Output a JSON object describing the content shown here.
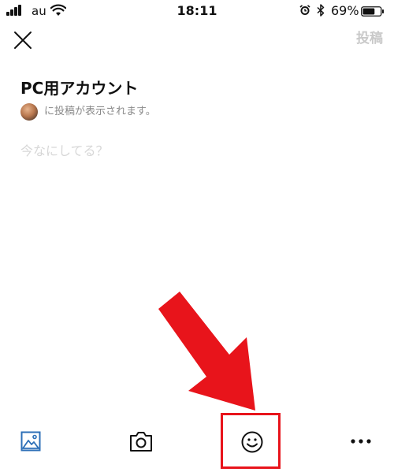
{
  "status_bar": {
    "carrier": "au",
    "time": "18:11",
    "battery_percent": "69%",
    "battery_level": 0.69,
    "signal_bars": 4
  },
  "header": {
    "close_icon": "close-icon",
    "post_label": "投稿"
  },
  "account": {
    "name": "PC用アカウント",
    "visibility_text": "に投稿が表示されます。"
  },
  "composer": {
    "placeholder": "今なにしてる？"
  },
  "toolbar": {
    "items": [
      {
        "icon": "photo-icon"
      },
      {
        "icon": "camera-icon"
      },
      {
        "icon": "emoji-icon"
      },
      {
        "icon": "more-icon"
      }
    ]
  },
  "annotation": {
    "color": "#e8141b",
    "target": "emoji-button"
  }
}
